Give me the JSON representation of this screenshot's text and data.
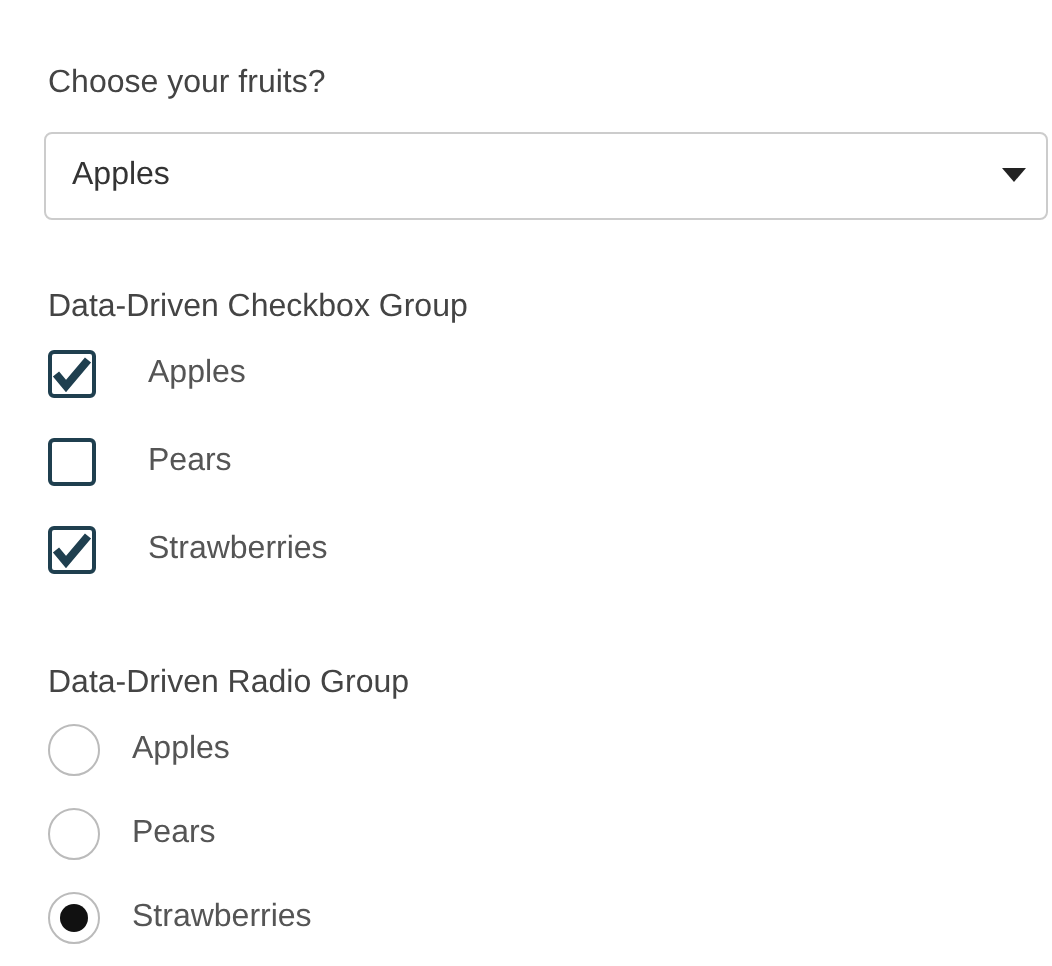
{
  "select": {
    "label": "Choose your fruits?",
    "value": "Apples"
  },
  "checkbox_group": {
    "label": "Data-Driven Checkbox Group",
    "items": [
      {
        "label": "Apples",
        "checked": true
      },
      {
        "label": "Pears",
        "checked": false
      },
      {
        "label": "Strawberries",
        "checked": true
      }
    ]
  },
  "radio_group": {
    "label": "Data-Driven Radio Group",
    "items": [
      {
        "label": "Apples",
        "selected": false
      },
      {
        "label": "Pears",
        "selected": false
      },
      {
        "label": "Strawberries",
        "selected": true
      }
    ]
  }
}
